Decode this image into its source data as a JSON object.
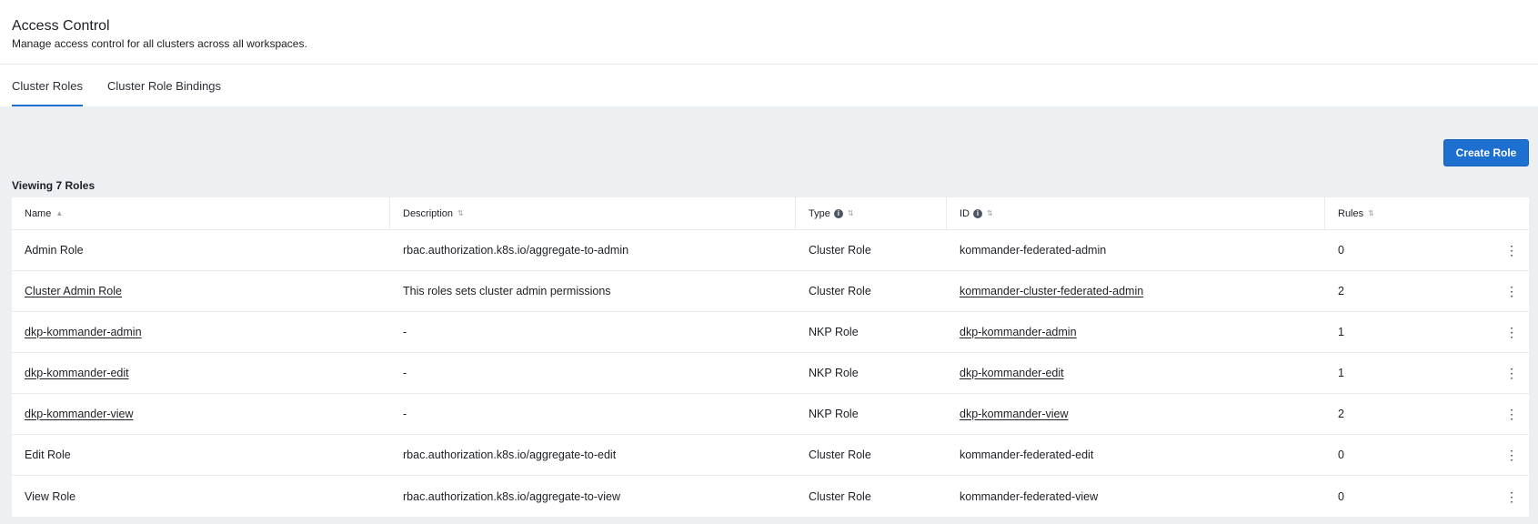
{
  "header": {
    "title": "Access Control",
    "subtitle": "Manage access control for all clusters across all workspaces."
  },
  "tabs": [
    {
      "label": "Cluster Roles",
      "active": true
    },
    {
      "label": "Cluster Role Bindings",
      "active": false
    }
  ],
  "toolbar": {
    "create_label": "Create Role"
  },
  "summary": "Viewing 7 Roles",
  "columns": {
    "name": "Name",
    "description": "Description",
    "type": "Type",
    "id": "ID",
    "rules": "Rules"
  },
  "icons": {
    "sort": "sort-icon",
    "info": "info-icon",
    "more": "kebab-menu-icon"
  },
  "colors": {
    "accent": "#1d6fd0",
    "background": "#edf0f3"
  },
  "rows": [
    {
      "name": "Admin Role",
      "description": "rbac.authorization.k8s.io/aggregate-to-admin",
      "type": "Cluster Role",
      "id": "kommander-federated-admin",
      "rules": "0"
    },
    {
      "name": "Cluster Admin Role",
      "description": "This roles sets cluster admin permissions",
      "type": "Cluster Role",
      "id": "kommander-cluster-federated-admin",
      "rules": "2"
    },
    {
      "name": "dkp-kommander-admin",
      "description": "-",
      "type": "NKP Role",
      "id": "dkp-kommander-admin",
      "rules": "1"
    },
    {
      "name": "dkp-kommander-edit",
      "description": "-",
      "type": "NKP Role",
      "id": "dkp-kommander-edit",
      "rules": "1"
    },
    {
      "name": "dkp-kommander-view",
      "description": "-",
      "type": "NKP Role",
      "id": "dkp-kommander-view",
      "rules": "2"
    },
    {
      "name": "Edit Role",
      "description": "rbac.authorization.k8s.io/aggregate-to-edit",
      "type": "Cluster Role",
      "id": "kommander-federated-edit",
      "rules": "0"
    },
    {
      "name": "View Role",
      "description": "rbac.authorization.k8s.io/aggregate-to-view",
      "type": "Cluster Role",
      "id": "kommander-federated-view",
      "rules": "0"
    }
  ]
}
